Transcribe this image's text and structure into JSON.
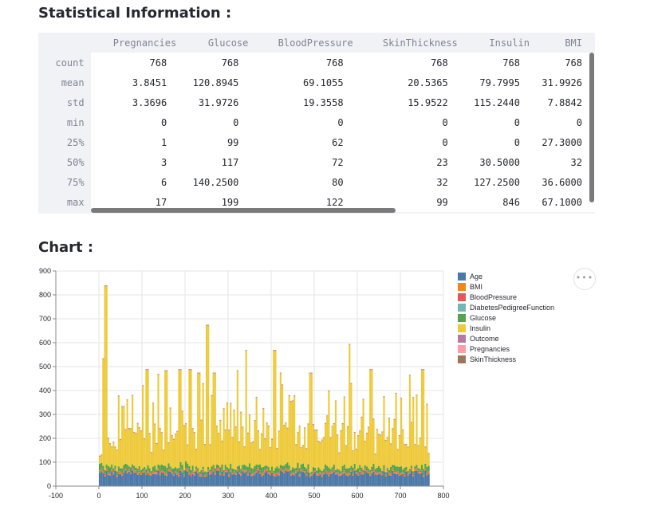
{
  "stats": {
    "heading": "Statistical Information :",
    "columns": [
      "Pregnancies",
      "Glucose",
      "BloodPressure",
      "SkinThickness",
      "Insulin",
      "BMI"
    ],
    "rows": [
      {
        "label": "count",
        "values": [
          "768",
          "768",
          "768",
          "768",
          "768",
          "768"
        ]
      },
      {
        "label": "mean",
        "values": [
          "3.8451",
          "120.8945",
          "69.1055",
          "20.5365",
          "79.7995",
          "31.9926"
        ]
      },
      {
        "label": "std",
        "values": [
          "3.3696",
          "31.9726",
          "19.3558",
          "15.9522",
          "115.2440",
          "7.8842"
        ]
      },
      {
        "label": "min",
        "values": [
          "0",
          "0",
          "0",
          "0",
          "0",
          "0"
        ]
      },
      {
        "label": "25%",
        "values": [
          "1",
          "99",
          "62",
          "0",
          "0",
          "27.3000"
        ]
      },
      {
        "label": "50%",
        "values": [
          "3",
          "117",
          "72",
          "23",
          "30.5000",
          "32"
        ]
      },
      {
        "label": "75%",
        "values": [
          "6",
          "140.2500",
          "80",
          "32",
          "127.2500",
          "36.6000"
        ]
      },
      {
        "label": "max",
        "values": [
          "17",
          "199",
          "122",
          "99",
          "846",
          "67.1000"
        ]
      }
    ]
  },
  "chart": {
    "heading": "Chart :",
    "more_button": "•••",
    "legend": [
      {
        "name": "Age",
        "color": "#4c78a8"
      },
      {
        "name": "BMI",
        "color": "#f58518"
      },
      {
        "name": "BloodPressure",
        "color": "#e45756"
      },
      {
        "name": "DiabetesPedigreeFunction",
        "color": "#72b7b2"
      },
      {
        "name": "Glucose",
        "color": "#54a24b"
      },
      {
        "name": "Insulin",
        "color": "#eeca3b"
      },
      {
        "name": "Outcome",
        "color": "#b279a2"
      },
      {
        "name": "Pregnancies",
        "color": "#ff9da6"
      },
      {
        "name": "SkinThickness",
        "color": "#9d755d"
      }
    ]
  },
  "chart_data": {
    "type": "bar",
    "stacked": true,
    "xlabel": "",
    "ylabel": "",
    "xlim": [
      -100,
      800
    ],
    "ylim": [
      0,
      900
    ],
    "x_ticks": [
      -100,
      0,
      100,
      200,
      300,
      400,
      500,
      600,
      700,
      800
    ],
    "y_ticks": [
      0,
      100,
      200,
      300,
      400,
      500,
      600,
      700,
      800,
      900
    ],
    "grid": true,
    "legend_position": "right",
    "x_range": [
      0,
      767
    ],
    "series_order": [
      "Age",
      "BMI",
      "BloodPressure",
      "DiabetesPedigreeFunction",
      "Glucose",
      "Insulin",
      "Outcome",
      "Pregnancies",
      "SkinThickness"
    ],
    "approx_stack_totals_sampled": [
      {
        "x": 0,
        "total": 180
      },
      {
        "x": 8,
        "total": 540
      },
      {
        "x": 13,
        "total": 845
      },
      {
        "x": 25,
        "total": 230
      },
      {
        "x": 55,
        "total": 340
      },
      {
        "x": 75,
        "total": 240
      },
      {
        "x": 110,
        "total": 495
      },
      {
        "x": 155,
        "total": 490
      },
      {
        "x": 185,
        "total": 495
      },
      {
        "x": 210,
        "total": 495
      },
      {
        "x": 230,
        "total": 480
      },
      {
        "x": 230,
        "total": 745
      },
      {
        "x": 250,
        "total": 680
      },
      {
        "x": 265,
        "total": 480
      },
      {
        "x": 320,
        "total": 490
      },
      {
        "x": 340,
        "total": 575
      },
      {
        "x": 405,
        "total": 575
      },
      {
        "x": 420,
        "total": 480
      },
      {
        "x": 490,
        "total": 480
      },
      {
        "x": 580,
        "total": 600
      },
      {
        "x": 630,
        "total": 495
      },
      {
        "x": 700,
        "total": 375
      },
      {
        "x": 750,
        "total": 495
      },
      {
        "x": 767,
        "total": 180
      }
    ]
  }
}
